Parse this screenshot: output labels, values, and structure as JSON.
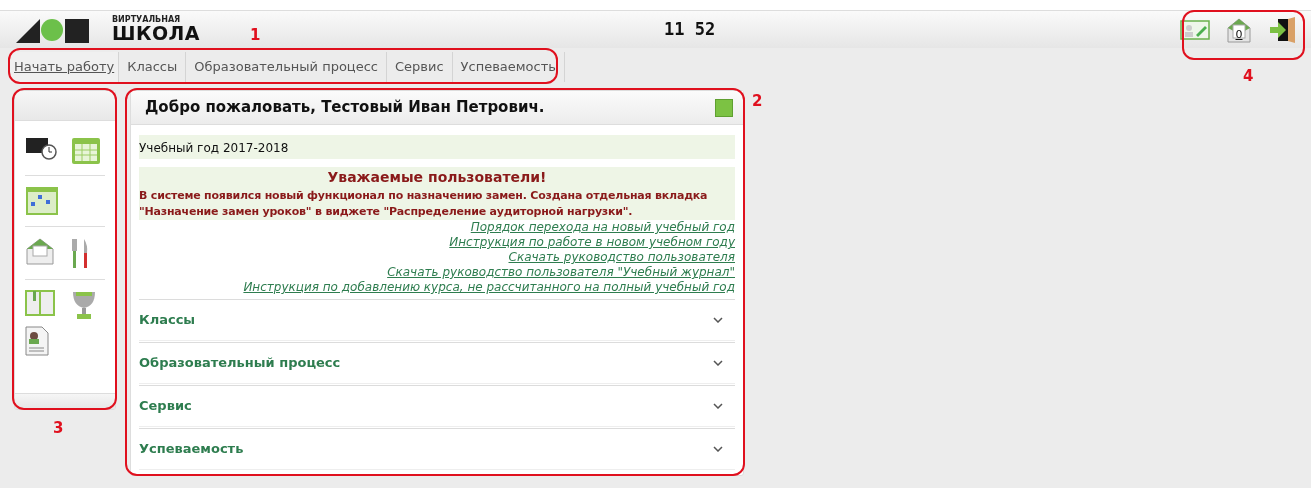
{
  "logo": {
    "line_1": "ВИРТУАЛЬНАЯ",
    "line_2": "ШКОЛА"
  },
  "clock": "11 52",
  "header_actions": {
    "mail_count": "0"
  },
  "nav": [
    {
      "label": "Начать работу",
      "selected": true
    },
    {
      "label": "Классы",
      "selected": false
    },
    {
      "label": "Образовательный процесс",
      "selected": false
    },
    {
      "label": "Сервис",
      "selected": false
    },
    {
      "label": "Успеваемость",
      "selected": false
    }
  ],
  "welcome": {
    "title": "Добро пожаловать, Тестовый Иван Петрович.",
    "school_year": "Учебный год 2017-2018",
    "notice_title": "Уважаемые пользователи!",
    "notice_text": "В системе появился новый функционал по назначению замен. Создана отдельная вкладка \"Назначение замен уроков\" в виджете \"Распределение аудиторной нагрузки\".",
    "links": [
      "Порядок перехода на новый учебный год",
      "Инструкция по работе в новом учебном году",
      "Скачать руководство пользователя",
      "Скачать руководство пользователя \"Учебный журнал\"",
      "Инструкция по добавлению курса, не рассчитанного на полный учебный год"
    ],
    "sections": [
      {
        "label": "Классы",
        "expanded": false
      },
      {
        "label": "Образовательный процесс",
        "expanded": false
      },
      {
        "label": "Сервис",
        "expanded": false
      },
      {
        "label": "Успеваемость",
        "expanded": false
      }
    ]
  },
  "annotations": [
    {
      "label": "1"
    },
    {
      "label": "2"
    },
    {
      "label": "3"
    },
    {
      "label": "4"
    }
  ]
}
